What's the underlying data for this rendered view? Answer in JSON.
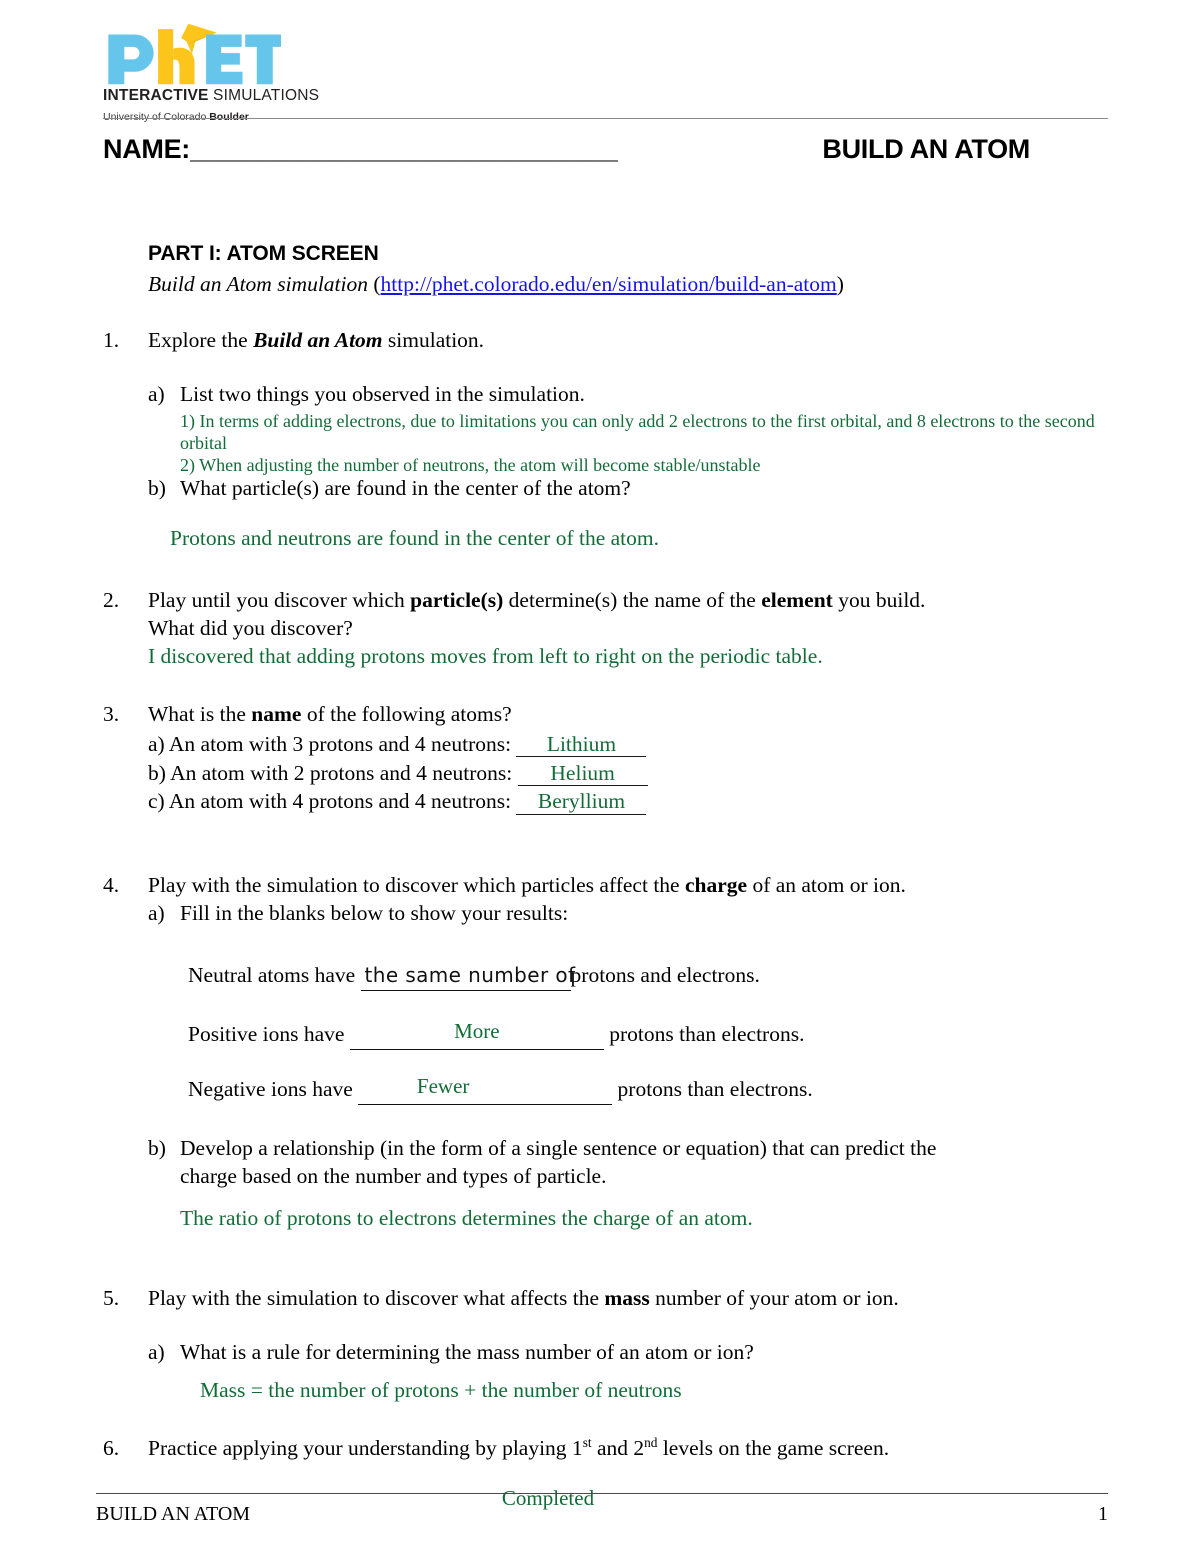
{
  "logo": {
    "wordmark": "PhET",
    "tagline_bold": "INTERACTIVE",
    "tagline_light": " SIMULATIONS",
    "university_light": "University of Colorado ",
    "university_bold": "Boulder",
    "colors": {
      "blue": "#66c5ea",
      "yellow": "#fbc51b",
      "dark": "#231f20"
    }
  },
  "header": {
    "name_label": "NAME:",
    "name_blank": "_______________________________",
    "doc_title": "BUILD AN ATOM"
  },
  "part": {
    "heading": "PART I: ATOM SCREEN",
    "sim_prefix": "Build an Atom simulation ",
    "sim_link": "http://phet.colorado.edu/en/simulation/build-an-atom",
    "open_paren": "(",
    "close_paren": ")"
  },
  "questions": {
    "q1": {
      "num": "1.",
      "text_before": "Explore the ",
      "text_bold": "Build an Atom",
      "text_after": " simulation.",
      "a_label": "a)",
      "a_text": "List two things you observed in the simulation.",
      "a_answer_1": "1) In terms of adding electrons, due to limitations you can only add 2 electrons to the first orbital, and 8 electrons to the second orbital",
      "a_answer_2": "2) When adjusting the number of neutrons, the atom will become stable/unstable",
      "b_label": "b)",
      "b_text": "What particle(s) are found in the center of the atom?",
      "b_answer": "Protons and neutrons are found in the center of the atom."
    },
    "q2": {
      "num": "2.",
      "line1_a": "Play until you discover which ",
      "line1_bold1": "particle(s)",
      "line1_b": " determine(s) the name of the ",
      "line1_bold2": "element",
      "line1_c": " you build.",
      "line2": "What did you discover?",
      "answer": "I discovered that adding protons moves from left to right on the periodic table."
    },
    "q3": {
      "num": "3.",
      "prompt_a": "What is the ",
      "prompt_bold": "name",
      "prompt_b": " of the following atoms?",
      "items": [
        {
          "label": "a) An atom with 3 protons and 4 neutrons:",
          "answer": "Lithium"
        },
        {
          "label": "b) An atom with 2 protons and 4 neutrons:",
          "answer": "Helium"
        },
        {
          "label": "c) An atom with 4 protons and 4 neutrons:",
          "answer": "Beryllium"
        }
      ]
    },
    "q4": {
      "num": "4.",
      "prompt_a": "Play with the simulation to discover which particles affect the ",
      "prompt_bold": "charge",
      "prompt_b": " of an atom or ion.",
      "a_label": "a)",
      "a_text": "Fill in the blanks below to show your results:",
      "blanks": [
        {
          "before": "Neutral atoms have",
          "fill": "the same number of",
          "after": "protons and electrons.",
          "style": "hand"
        },
        {
          "before": "Positive ions have",
          "fill": "More",
          "after": "protons than electrons.",
          "style": "green"
        },
        {
          "before": "Negative ions have",
          "fill": "Fewer",
          "after": "protons than electrons.",
          "style": "green"
        }
      ],
      "b_label": "b)",
      "b_text_line1": "Develop a relationship (in the form of a single sentence or equation) that can predict the",
      "b_text_line2": "charge based on the number and types of particle.",
      "b_answer": "The ratio of protons to electrons determines the charge of an atom."
    },
    "q5": {
      "num": "5.",
      "prompt_a": "Play with the simulation to discover what affects the ",
      "prompt_bold": "mass",
      "prompt_b": " number of your atom or ion.",
      "a_label": "a)",
      "a_text": "What is a rule for determining the mass number of an atom or ion?",
      "a_answer": "Mass = the number of protons + the number of neutrons"
    },
    "q6": {
      "num": "6.",
      "text_a": "Practice applying your understanding by playing 1",
      "sup_1": "st",
      "text_b": " and 2",
      "sup_2": "nd",
      "text_c": " levels on the game screen.",
      "answer": "Completed"
    }
  },
  "footer": {
    "left": "BUILD AN ATOM",
    "page": "1"
  },
  "colors": {
    "answer_green": "#136c38",
    "link_blue": "#1515e8",
    "rule_gray": "#8a8a8a"
  }
}
